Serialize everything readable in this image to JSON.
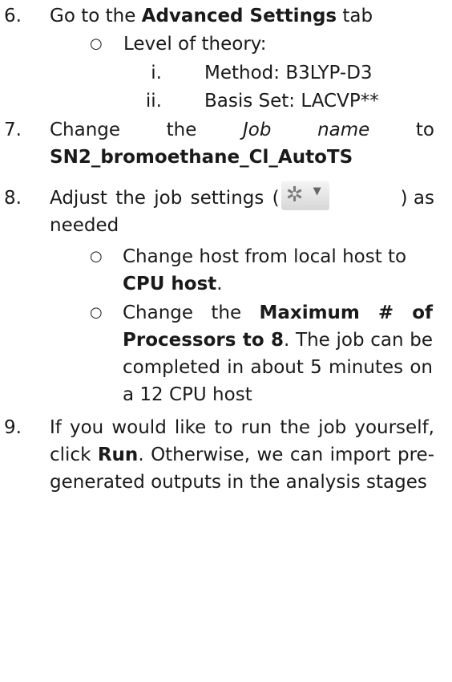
{
  "steps": {
    "s6": {
      "number": "6.",
      "prefix": "Go to the ",
      "bold": "Advanced Settings",
      "suffix": " tab",
      "sub": {
        "label": "Level of theory:",
        "items": [
          {
            "numeral": "i.",
            "text": "Method: B3LYP-D3"
          },
          {
            "numeral": "ii.",
            "text": "Basis Set: LACVP**"
          }
        ]
      }
    },
    "s7": {
      "number": "7.",
      "w1": "Change",
      "w2": "the",
      "w3": "Job",
      "w4": "name",
      "w5": "to",
      "job_name": "SN2_bromoethane_Cl_AutoTS"
    },
    "s8": {
      "number": "8.",
      "prefix": "Adjust the job settings (",
      "suffix": ") as",
      "line2": "needed",
      "icon": "gear-dropdown-icon",
      "bullets": [
        {
          "a": "Change host from local host to ",
          "b": "CPU host",
          "c": "."
        },
        {
          "a": "Change the ",
          "b": "Maximum # of Processors to 8",
          "c": ". The job can be completed in about 5 minutes on a 12 CPU host"
        }
      ]
    },
    "s9": {
      "number": "9.",
      "a": "If you would like to run the job yourself, click ",
      "b": "Run",
      "c": ". Otherwise, we can import pre-generated outputs in the analysis stages"
    }
  }
}
